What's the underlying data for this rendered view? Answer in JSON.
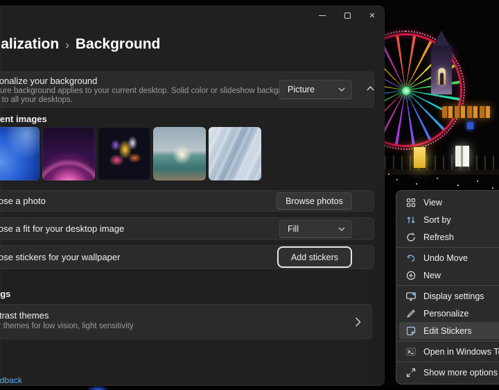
{
  "window": {
    "breadcrumb": {
      "parent": "Personalization",
      "separator": "›",
      "current": "Background"
    },
    "personalize_card": {
      "title": "Personalize your background",
      "description_line1": "A picture background applies to your current desktop. Solid color or slideshow backgrounds",
      "description_line2": "apply to all your desktops.",
      "style_dropdown_value": "Picture"
    },
    "recent_images": {
      "label": "Recent images",
      "thumbnails": [
        {
          "name": "windows-bloom-blue"
        },
        {
          "name": "glow-arc-purple"
        },
        {
          "name": "abstract-flower-dark"
        },
        {
          "name": "lake-sunrise"
        },
        {
          "name": "paper-bloom-light"
        }
      ]
    },
    "photo_row": {
      "label": "Choose a photo",
      "button_label": "Browse photos"
    },
    "fit_row": {
      "label": "Choose a fit for your desktop image",
      "dropdown_value": "Fill"
    },
    "stickers_row": {
      "label": "Choose stickers for your wallpaper",
      "button_label": "Add stickers"
    },
    "related_settings": {
      "header": "Related settings",
      "contrast_card": {
        "title": "Contrast themes",
        "description": "Color themes for low vision, light sensitivity"
      }
    },
    "feedback_link": "Give feedback"
  },
  "context_menu": {
    "items": [
      {
        "label": "View",
        "icon": "grid-view-icon"
      },
      {
        "label": "Sort by",
        "icon": "sort-icon"
      },
      {
        "label": "Refresh",
        "icon": "refresh-icon"
      },
      {
        "label": "Undo Move",
        "icon": "undo-icon"
      },
      {
        "label": "New",
        "icon": "new-icon"
      },
      {
        "label": "Display settings",
        "icon": "display-icon"
      },
      {
        "label": "Personalize",
        "icon": "personalize-icon"
      },
      {
        "label": "Edit Stickers",
        "icon": "sticker-icon",
        "highlighted": true
      },
      {
        "label": "Open in Windows Terminal",
        "icon": "terminal-icon"
      },
      {
        "label": "Show more options",
        "icon": "show-more-icon"
      }
    ]
  },
  "colors": {
    "accent_link": "#57aef0",
    "focus_ring": "#e8e8e8",
    "menu_highlight": "#3f3f3f",
    "wheel_rim": "#d81745",
    "window_bg": "#202020",
    "card_bg": "#2b2b2b"
  }
}
